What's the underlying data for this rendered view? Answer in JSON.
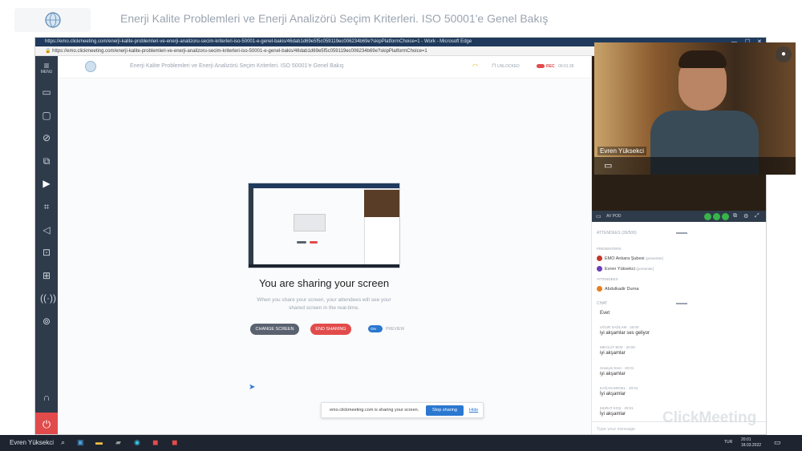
{
  "outer": {
    "title": "Enerji Kalite Problemleri ve Enerji Analizörü Seçim Kriterleri. ISO 50001'e Genel Bakış"
  },
  "browser": {
    "window_title": "https://emo.clickmeeting.com/enerji-kalite-problemleri-ve-enerji-analizoru-secim-kriterleri-iso-50001-e-genel-bakis/46dab1d69e5f5c059119ec006234b69e?skipPlatformChoice=1 - Work - Microsoft Edge",
    "url": "https://emo.clickmeeting.com/enerji-kalite-problemleri-ve-enerji-analizoru-secim-kriterleri-iso-50001-e-genel-bakis/46dab1d69e5f5c059119ec006234b69e?skipPlatformChoice=1"
  },
  "rail": {
    "menu_label": "MENU"
  },
  "app": {
    "title": "Enerji Kalite Problemleri ve Enerji Analizörü Seçim Kriterleri. ISO 50001'e Genel Bakış",
    "lock_status": "UNLOCKED",
    "rec_label": "REC",
    "rec_time": "00:01:39"
  },
  "stage": {
    "heading": "You are sharing your screen",
    "description": "When you share your screen, your attendees will see your shared screen in the real-time.",
    "change_screen": "CHANGE SCREEN",
    "end_sharing": "END SHARING",
    "toggle_state": "ON",
    "preview_label": "PREVIEW"
  },
  "banner": {
    "text": "emo.clickmeeting.com is sharing your screen.",
    "stop_sharing": "Stop sharing",
    "hide": "Hide"
  },
  "side_panel": {
    "av_pod": "AV POD",
    "attendees_header": "ATTENDEES (26/500)",
    "presenters_label": "PRESENTERS",
    "presenters": [
      {
        "name": "EMO Ankara Şubesi",
        "role": "(presenter)",
        "color": "#c0392b"
      },
      {
        "name": "Evren Yüksekci",
        "role": "(presenter)",
        "color": "#6a3fb5"
      }
    ],
    "attendees_label": "ATTENDEES",
    "attendees": [
      {
        "name": "Abdulkadir Durna",
        "color": "#e67e22"
      }
    ],
    "chat_header": "CHAT",
    "chat": [
      {
        "meta": "",
        "text": "Evet"
      },
      {
        "meta": "UĞUR SAĞLAM · 20:00",
        "text": "iyi akşamlar ses geliyor"
      },
      {
        "meta": "MEVLÜT BOZ · 20:00",
        "text": "iyi akşamlar"
      },
      {
        "meta": "Hüseyin Eren · 20:01",
        "text": "iyi akşamlar"
      },
      {
        "meta": "KAĞAN ERGEL · 20:01",
        "text": "İyi akşamlar"
      },
      {
        "meta": "MURAT KOŞ · 20:01",
        "text": "İyi akşamlar"
      }
    ],
    "chat_placeholder": "Type your message"
  },
  "webcam": {
    "name": "Evren Yüksekci"
  },
  "watermark": "ClickMeeting",
  "taskbar": {
    "user": "Evren Yüksekci",
    "lang": "TUR",
    "time": "20:01",
    "date": "18.03.2022"
  }
}
